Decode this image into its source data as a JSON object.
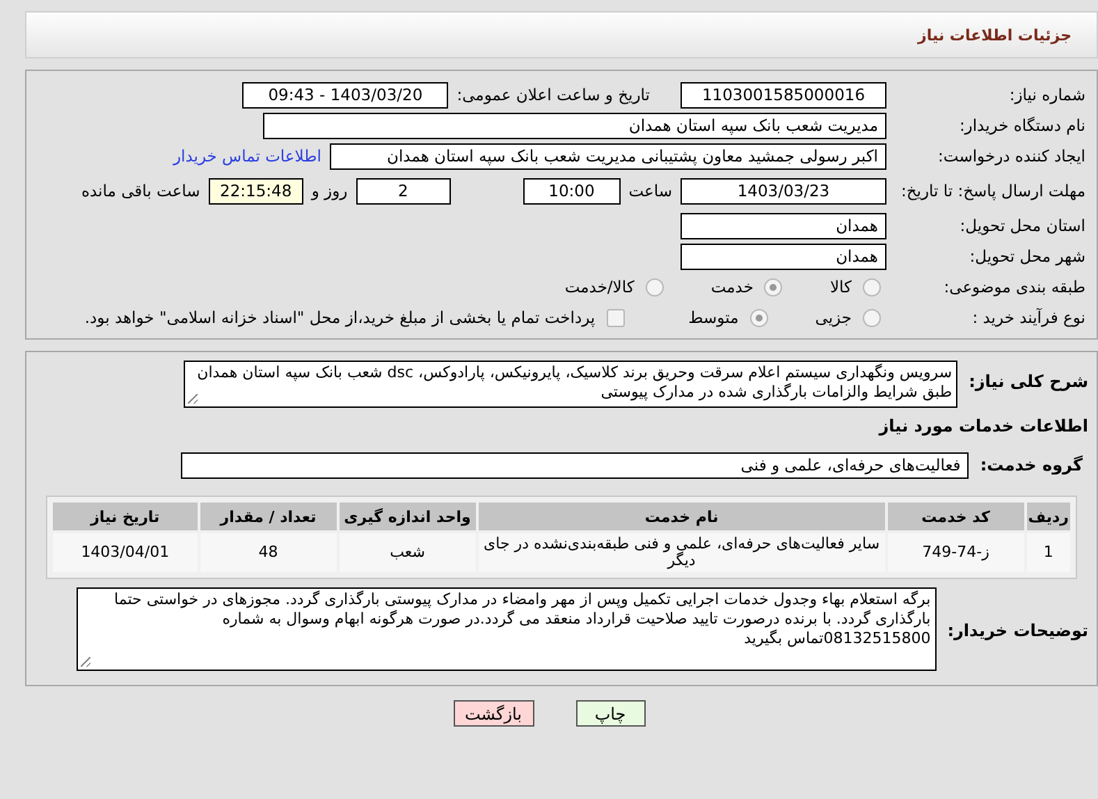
{
  "header": {
    "title": "جزئیات اطلاعات نیاز"
  },
  "details": {
    "need_number": {
      "label": "شماره نیاز:",
      "value": "1103001585000016"
    },
    "announce": {
      "label": "تاریخ و ساعت اعلان عمومی:",
      "value": "1403/03/20 - 09:43"
    },
    "buyer": {
      "label": "نام دستگاه خریدار:",
      "value": "مدیریت شعب بانک سپه استان همدان"
    },
    "creator": {
      "label": "ایجاد کننده درخواست:",
      "value": "اکبر رسولی جمشید معاون پشتیبانی مدیریت شعب بانک سپه استان همدان",
      "link": "اطلاعات تماس خریدار"
    },
    "deadline": {
      "label": "مهلت ارسال پاسخ: تا تاریخ:",
      "date": "1403/03/23",
      "time_label": "ساعت",
      "time": "10:00",
      "days": "2",
      "days_label": "روز و",
      "remaining": "22:15:48",
      "remaining_label": "ساعت باقی مانده"
    },
    "province": {
      "label": "استان محل تحویل:",
      "value": "همدان"
    },
    "city": {
      "label": "شهر محل تحویل:",
      "value": "همدان"
    },
    "category": {
      "label": "طبقه بندی موضوعی:",
      "options": [
        {
          "label": "كالا",
          "selected": false
        },
        {
          "label": "خدمت",
          "selected": true
        },
        {
          "label": "كالا/خدمت",
          "selected": false
        }
      ]
    },
    "process": {
      "label": "نوع فرآیند خرید :",
      "options": [
        {
          "label": "جزیی",
          "selected": false
        },
        {
          "label": "متوسط",
          "selected": true
        }
      ],
      "payment": {
        "checked": false,
        "text": "پرداخت تمام یا بخشی از مبلغ خرید،از محل \"اسناد خزانه اسلامی\" خواهد بود."
      }
    }
  },
  "need": {
    "label": "شرح کلی نیاز:",
    "value": "سرویس ونگهداری  سیستم اعلام سرقت وحریق  برند کلاسیک، پایرونیکس، پارادوکس، dsc شعب بانک سپه استان همدان طبق شرایط والزامات بارگذاری شده در مدارک پیوستی"
  },
  "services_title": "اطلاعات خدمات مورد نیاز",
  "service_group": {
    "label": "گروه خدمت:",
    "value": "فعالیت‌های حرفه‌ای، علمی و فنی"
  },
  "table": {
    "columns": [
      "ردیف",
      "کد خدمت",
      "نام خدمت",
      "واحد اندازه گیری",
      "تعداد / مقدار",
      "تاریخ نیاز"
    ],
    "rows": [
      [
        "1",
        "ز-74-749",
        "سایر فعالیت‌های حرفه‌ای، علمی و فنی طبقه‌بندی‌نشده در جای دیگر",
        "شعب",
        "48",
        "1403/04/01"
      ]
    ]
  },
  "notes": {
    "label": "توضیحات خریدار:",
    "value": "برگه استعلام بهاء وجدول خدمات اجرایی تکمیل وپس از مهر وامضاء در مدارک پیوستی بارگذاری گردد. مجوزهای در خواستی حتما بارگذاری گردد. با برنده درصورت تایید صلاحیت  قرارداد منعقد می گردد.در صورت هرگونه ابهام وسوال به شماره 08132515800تماس بگیرید"
  },
  "buttons": [
    {
      "label": "چاپ",
      "kind": "print"
    },
    {
      "label": "بازگشت",
      "kind": "back"
    }
  ]
}
